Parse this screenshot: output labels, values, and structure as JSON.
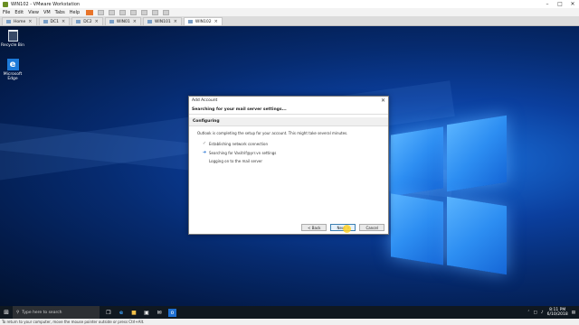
{
  "vmware": {
    "title": "WIN102 - VMware Workstation",
    "menu": [
      "File",
      "Edit",
      "View",
      "VM",
      "Tabs",
      "Help"
    ],
    "tabs": [
      {
        "label": "Home",
        "active": false
      },
      {
        "label": "DC1",
        "active": false
      },
      {
        "label": "DC2",
        "active": false
      },
      {
        "label": "WIN01",
        "active": false
      },
      {
        "label": "WIN101",
        "active": false
      },
      {
        "label": "WIN102",
        "active": true
      }
    ],
    "status_text": "To return to your computer, move the mouse pointer outside or press Ctrl+Alt."
  },
  "desktop": {
    "icons": [
      {
        "label": "Recycle Bin",
        "icon": "recycle-bin-icon"
      },
      {
        "label": "Microsoft Edge",
        "icon": "edge-icon"
      }
    ]
  },
  "dialog": {
    "title": "Add Account",
    "heading": "Searching for your mail server settings...",
    "section": "Configuring",
    "description": "Outlook is completing the setup for your account. This might take several minutes.",
    "steps": [
      {
        "label": "Establishing network connection",
        "state": "done"
      },
      {
        "label": "Searching for Vasitrif@yrr.vn settings",
        "state": "current"
      },
      {
        "label": "Logging on to the mail server",
        "state": "pending"
      }
    ],
    "buttons": {
      "back": "< Back",
      "next": "Next >",
      "cancel": "Cancel"
    }
  },
  "taskbar": {
    "search_placeholder": "Type here to search",
    "time": "8:11 PM",
    "date": "6/10/2018"
  },
  "colors": {
    "accent": "#1f6fd1",
    "pause": "#e8742a",
    "desktop": "#0b3f9e"
  }
}
